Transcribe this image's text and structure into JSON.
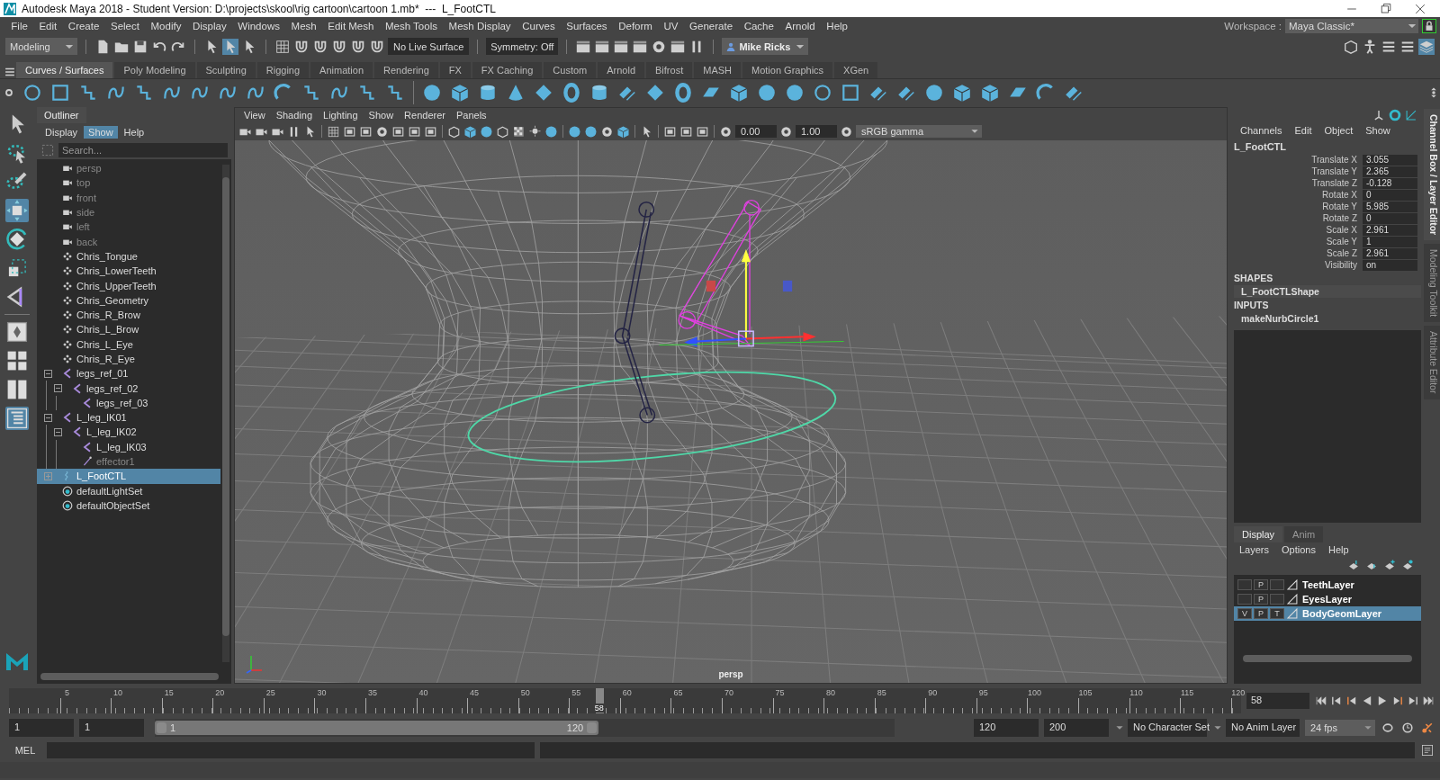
{
  "window": {
    "title": "Autodesk Maya 2018 - Student Version: D:\\projects\\skool\\rig cartoon\\cartoon 1.mb*  ---  L_FootCTL"
  },
  "menu": [
    "File",
    "Edit",
    "Create",
    "Select",
    "Modify",
    "Display",
    "Windows",
    "Mesh",
    "Edit Mesh",
    "Mesh Tools",
    "Mesh Display",
    "Curves",
    "Surfaces",
    "Deform",
    "UV",
    "Generate",
    "Cache",
    "Arnold",
    "Help"
  ],
  "workspace": {
    "label": "Workspace :",
    "value": "Maya Classic*"
  },
  "status_line": {
    "mode": "Modeling",
    "live_surface": "No Live Surface",
    "symmetry": "Symmetry: Off",
    "user": "Mike Ricks"
  },
  "shelf": {
    "tabs": [
      {
        "label": "Curves / Surfaces",
        "selected": true
      },
      {
        "label": "Poly Modeling",
        "selected": false
      },
      {
        "label": "Sculpting",
        "selected": false
      },
      {
        "label": "Rigging",
        "selected": false
      },
      {
        "label": "Animation",
        "selected": false
      },
      {
        "label": "Rendering",
        "selected": false
      },
      {
        "label": "FX",
        "selected": false
      },
      {
        "label": "FX Caching",
        "selected": false
      },
      {
        "label": "Custom",
        "selected": false
      },
      {
        "label": "Arnold",
        "selected": false
      },
      {
        "label": "Bifrost",
        "selected": false
      },
      {
        "label": "MASH",
        "selected": false
      },
      {
        "label": "Motion Graphics",
        "selected": false
      },
      {
        "label": "XGen",
        "selected": false
      }
    ]
  },
  "toolbox": {
    "tools": [
      {
        "kind": "select",
        "selected": false
      },
      {
        "kind": "lasso",
        "selected": false
      },
      {
        "kind": "paint",
        "selected": false
      },
      {
        "kind": "move",
        "selected": true
      },
      {
        "kind": "rotate",
        "selected": false
      },
      {
        "kind": "scale",
        "selected": false
      },
      {
        "kind": "soft",
        "selected": false
      }
    ],
    "layouts": [
      {
        "kind": "single",
        "selected": false
      },
      {
        "kind": "quad",
        "selected": false
      },
      {
        "kind": "split",
        "selected": false
      },
      {
        "kind": "outliner",
        "selected": true
      }
    ]
  },
  "outliner": {
    "title": "Outliner",
    "menu": [
      {
        "label": "Display",
        "selected": false
      },
      {
        "label": "Show",
        "selected": true
      },
      {
        "label": "Help",
        "selected": false
      }
    ],
    "search": {
      "placeholder": "Search..."
    },
    "items": [
      {
        "label": "persp",
        "kind": "camera",
        "dimmed": true,
        "selected": false
      },
      {
        "label": "top",
        "kind": "camera",
        "dimmed": true,
        "selected": false
      },
      {
        "label": "front",
        "kind": "camera",
        "dimmed": true,
        "selected": false
      },
      {
        "label": "side",
        "kind": "camera",
        "dimmed": true,
        "selected": false
      },
      {
        "label": "left",
        "kind": "camera",
        "dimmed": true,
        "selected": false
      },
      {
        "label": "back",
        "kind": "camera",
        "dimmed": true,
        "selected": false
      },
      {
        "label": "Chris_Tongue",
        "kind": "transform",
        "dimmed": false,
        "selected": false
      },
      {
        "label": "Chris_LowerTeeth",
        "kind": "transform",
        "dimmed": false,
        "selected": false
      },
      {
        "label": "Chris_UpperTeeth",
        "kind": "transform",
        "dimmed": false,
        "selected": false
      },
      {
        "label": "Chris_Geometry",
        "kind": "transform",
        "dimmed": false,
        "selected": false
      },
      {
        "label": "Chris_R_Brow",
        "kind": "transform",
        "dimmed": false,
        "selected": false
      },
      {
        "label": "Chris_L_Brow",
        "kind": "transform",
        "dimmed": false,
        "selected": false
      },
      {
        "label": "Chris_L_Eye",
        "kind": "transform",
        "dimmed": false,
        "selected": false
      },
      {
        "label": "Chris_R_Eye",
        "kind": "transform",
        "dimmed": false,
        "selected": false
      },
      {
        "label": "legs_ref_01",
        "kind": "joint",
        "dimmed": false,
        "selected": false,
        "expanded": true,
        "children": [
          {
            "label": "legs_ref_02",
            "kind": "joint",
            "dimmed": false,
            "selected": false,
            "expanded": true,
            "children": [
              {
                "label": "legs_ref_03",
                "kind": "joint",
                "dimmed": false,
                "selected": false
              }
            ]
          }
        ]
      },
      {
        "label": "L_leg_IK01",
        "kind": "joint",
        "dimmed": false,
        "selected": false,
        "expanded": true,
        "children": [
          {
            "label": "L_leg_IK02",
            "kind": "joint",
            "dimmed": false,
            "selected": false,
            "expanded": true,
            "children": [
              {
                "label": "L_leg_IK03",
                "kind": "joint",
                "dimmed": false,
                "selected": false
              },
              {
                "label": "effector1",
                "kind": "effector",
                "dimmed": true,
                "selected": false
              }
            ]
          }
        ]
      },
      {
        "label": "L_FootCTL",
        "kind": "curve",
        "dimmed": false,
        "selected": true,
        "expanded": false
      },
      {
        "label": "defaultLightSet",
        "kind": "set",
        "dimmed": false,
        "selected": false
      },
      {
        "label": "defaultObjectSet",
        "kind": "set",
        "dimmed": false,
        "selected": false
      }
    ]
  },
  "viewport": {
    "menu": [
      "View",
      "Shading",
      "Lighting",
      "Show",
      "Renderer",
      "Panels"
    ],
    "exposure": "0.00",
    "gamma": "1.00",
    "color_space": "sRGB gamma",
    "camera": "persp"
  },
  "channel_box": {
    "menu": [
      "Channels",
      "Edit",
      "Object",
      "Show"
    ],
    "object": "L_FootCTL",
    "channels": [
      {
        "label": "Translate X",
        "value": "3.055"
      },
      {
        "label": "Translate Y",
        "value": "2.365"
      },
      {
        "label": "Translate Z",
        "value": "-0.128"
      },
      {
        "label": "Rotate X",
        "value": "0"
      },
      {
        "label": "Rotate Y",
        "value": "5.985"
      },
      {
        "label": "Rotate Z",
        "value": "0"
      },
      {
        "label": "Scale X",
        "value": "2.961"
      },
      {
        "label": "Scale Y",
        "value": "1"
      },
      {
        "label": "Scale Z",
        "value": "2.961"
      },
      {
        "label": "Visibility",
        "value": "on"
      }
    ],
    "shapes_heading": "SHAPES",
    "shapes": [
      "L_FootCTLShape"
    ],
    "inputs_heading": "INPUTS",
    "inputs": [
      "makeNurbCircle1"
    ]
  },
  "layer_editor": {
    "tabs": [
      {
        "label": "Display",
        "selected": true
      },
      {
        "label": "Anim",
        "selected": false
      }
    ],
    "menu": [
      "Layers",
      "Options",
      "Help"
    ],
    "layers": [
      {
        "name": "TeethLayer",
        "selected": false,
        "playback": "P"
      },
      {
        "name": "EyesLayer",
        "selected": false,
        "playback": "P"
      },
      {
        "name": "BodyGeomLayer",
        "selected": true,
        "visibility": "V",
        "playback": "P",
        "template": "T"
      }
    ]
  },
  "side_tabs": [
    {
      "label": "Channel Box / Layer Editor",
      "selected": true
    },
    {
      "label": "Modeling Toolkit",
      "selected": false
    },
    {
      "label": "Attribute Editor",
      "selected": false
    }
  ],
  "timeline": {
    "ticks": [
      "5",
      "10",
      "15",
      "20",
      "25",
      "30",
      "35",
      "40",
      "45",
      "50",
      "55",
      "60",
      "65",
      "70",
      "75",
      "80",
      "85",
      "90",
      "95",
      "100",
      "105",
      "110",
      "115",
      "120"
    ],
    "playhead": {
      "label": "58",
      "level": 0.479
    },
    "current_frame": "58"
  },
  "range": {
    "start": "1",
    "playback_start": "1",
    "slider": {
      "start": "1",
      "end": "120",
      "level": 0.6
    },
    "playback_end": "120",
    "end": "200",
    "character_set": "No Character Set",
    "anim_layer": "No Anim Layer",
    "fps": "24 fps"
  },
  "command_line": {
    "language": "MEL"
  }
}
